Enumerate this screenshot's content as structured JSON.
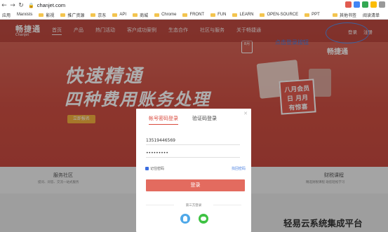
{
  "browser": {
    "url": "chanjet.com",
    "bookmarks": [
      "应用",
      "Marxists",
      "影视",
      "推广资源",
      "京东",
      "API",
      "商城",
      "Chrome",
      "FRONT",
      "FUN",
      "LEARN",
      "OPEN-SOURCE",
      "PPT"
    ],
    "bookmarks_right": [
      "其他书签",
      "阅读清单"
    ]
  },
  "site": {
    "logo_cn": "畅捷通",
    "logo_en": "Chanjet",
    "nav": [
      "首页",
      "产品",
      "热门活动",
      "客户成功案例",
      "生态合作",
      "社区与服务",
      "关于畅捷通"
    ],
    "login": "登录",
    "register": "注册",
    "annotation": "点击登录按钮",
    "hero_title": "快速精通",
    "hero_subtitle": "四种费用账务处理",
    "hero_button": "立即报名",
    "promo": "八月会员日 月月有惊喜",
    "badge": "8月",
    "second_logo": "畅捷通",
    "feature_left": "服务社区",
    "feature_left_sub": "提问、问答、交流一站式服务",
    "feature_right": "财税课程",
    "feature_right_sub": "精选财税课程  助您轻松学习"
  },
  "modal": {
    "tab_password": "帐号密码登录",
    "tab_code": "验证码登录",
    "phone": "13519446569",
    "password": "•••••••••",
    "remember": "记住密码",
    "forgot": "找回密码",
    "login_button": "登录",
    "third_party": "第三方登录"
  },
  "watermark": "轻易云系统集成平台",
  "colors": {
    "brand_red": "#d94a3d",
    "login_button": "#e36b5f",
    "annotation_blue": "#4a7fe0"
  }
}
